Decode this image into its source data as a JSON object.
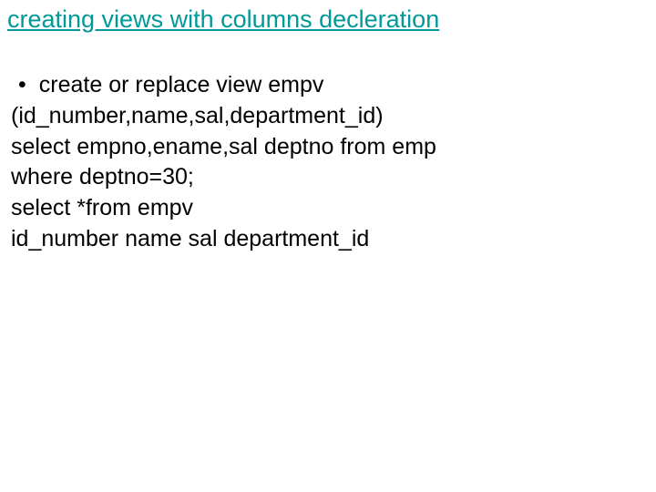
{
  "title": "creating views with columns decleration",
  "content": {
    "bullet_symbol": "•",
    "line1": "create or replace view empv",
    "line2": "(id_number,name,sal,department_id)",
    "line3": "select empno,ename,sal deptno from emp",
    "line4": "where deptno=30;",
    "line5": "select *from  empv",
    "line6": "id_number name sal department_id"
  }
}
